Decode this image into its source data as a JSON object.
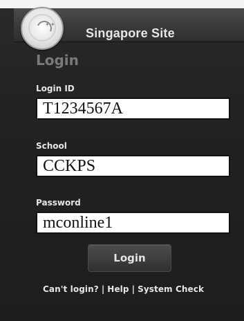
{
  "header": {
    "site_title": "Singapore Site"
  },
  "login": {
    "heading": "Login",
    "login_id": {
      "label": "Login ID",
      "value": "T1234567A"
    },
    "school": {
      "label": "School",
      "value": "CCKPS"
    },
    "password": {
      "label": "Password",
      "value": "mconline1"
    },
    "button_label": "Login"
  },
  "footer": {
    "links": [
      "Can't login?",
      "Help",
      "System Check"
    ],
    "separator": "|"
  },
  "icons": {
    "logo": "singapore-crest-icon"
  },
  "colors": {
    "background": "#1c1c1c",
    "banner": "#3b3b3b",
    "label_text": "#e6e6e6",
    "heading_text": "#7a7a7a",
    "input_bg": "#ffffff"
  }
}
